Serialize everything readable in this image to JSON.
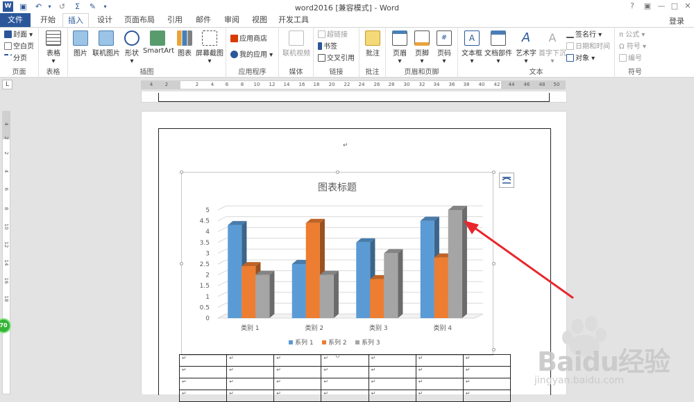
{
  "app": {
    "title": "word2016 [兼容模式] - Word",
    "login": "登录",
    "help": "?",
    "restore": "□",
    "minimize": "—",
    "close": "✕"
  },
  "quick_access": {
    "undo": "↶",
    "redo": "↺"
  },
  "tabs": [
    "文件",
    "开始",
    "插入",
    "设计",
    "页面布局",
    "引用",
    "邮件",
    "审阅",
    "视图",
    "开发工具"
  ],
  "active_tab": "插入",
  "ribbon": {
    "groups": {
      "pages": {
        "label": "页面",
        "items": [
          "封面",
          "空白页",
          "分页"
        ]
      },
      "table": {
        "label": "表格",
        "button": "表格"
      },
      "illustrations": {
        "label": "插图",
        "buttons": [
          "图片",
          "联机图片",
          "形状",
          "SmartArt",
          "图表",
          "屏幕截图"
        ]
      },
      "apps": {
        "label": "应用程序",
        "items": [
          "应用商店",
          "我的应用"
        ]
      },
      "media": {
        "label": "媒体",
        "button": "联机视频"
      },
      "links": {
        "label": "链接",
        "items": [
          "超链接",
          "书签",
          "交叉引用"
        ]
      },
      "comments": {
        "label": "批注",
        "button": "批注"
      },
      "header_footer": {
        "label": "页眉和页脚",
        "buttons": [
          "页眉",
          "页脚",
          "页码"
        ]
      },
      "text": {
        "label": "文本",
        "buttons": [
          "文本框",
          "文档部件",
          "艺术字",
          "首字下沉"
        ],
        "items": [
          "签名行",
          "日期和时间",
          "对象"
        ]
      },
      "symbols": {
        "label": "符号",
        "items": [
          "公式",
          "符号",
          "编号"
        ]
      }
    }
  },
  "ruler": {
    "h_ticks": [
      "4",
      "2",
      "2",
      "4",
      "6",
      "8",
      "10",
      "12",
      "14",
      "16",
      "18",
      "20",
      "22",
      "24",
      "26",
      "28",
      "30",
      "32",
      "34",
      "36",
      "38",
      "40",
      "42",
      "44",
      "46",
      "48",
      "50"
    ],
    "v_ticks": [
      "4",
      "2",
      "2",
      "4",
      "6",
      "8",
      "10",
      "12",
      "14",
      "16",
      "18"
    ],
    "corner": "L"
  },
  "zoom_badge": "70",
  "paragraph_mark": "↵",
  "chart_data": {
    "type": "bar",
    "title": "图表标题",
    "categories": [
      "类别 1",
      "类别 2",
      "类别 3",
      "类别 4"
    ],
    "series": [
      {
        "name": "系列 1",
        "values": [
          4.3,
          2.5,
          3.5,
          4.5
        ],
        "color": "#5b9bd5"
      },
      {
        "name": "系列 2",
        "values": [
          2.4,
          4.4,
          1.8,
          2.8
        ],
        "color": "#ed7d31"
      },
      {
        "name": "系列 3",
        "values": [
          2,
          2,
          3,
          5
        ],
        "color": "#a5a5a5"
      }
    ],
    "ylim": [
      0,
      5
    ],
    "yticks": [
      "0",
      "0.5",
      "1",
      "1.5",
      "2",
      "2.5",
      "3",
      "3.5",
      "4",
      "4.5",
      "5"
    ],
    "legend": "bottom",
    "grid": true,
    "style": "3d-column"
  },
  "table": {
    "rows": 4,
    "cols": 7,
    "cell_mark": "↵"
  },
  "watermark": {
    "text": "Baidu经验",
    "url": "jingyan.baidu.com"
  }
}
